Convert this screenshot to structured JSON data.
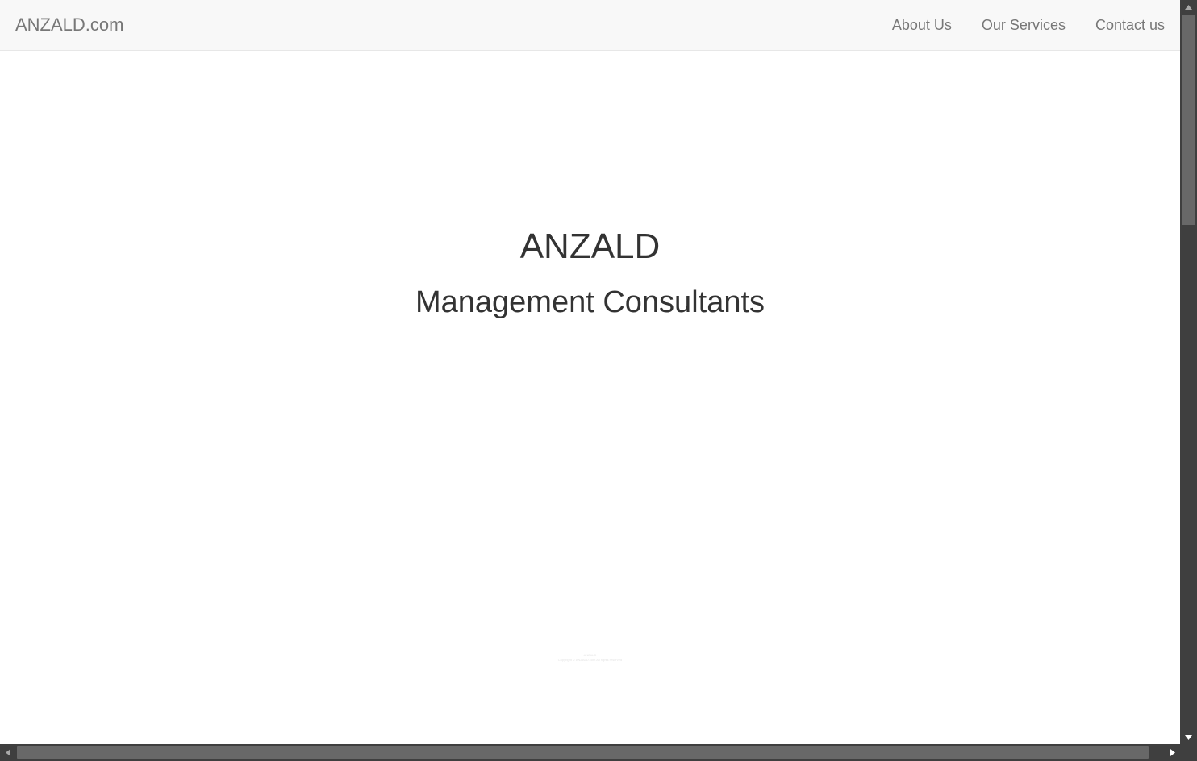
{
  "navbar": {
    "brand": "ANZALD.com",
    "links": [
      "About Us",
      "Our Services",
      "Contact us"
    ]
  },
  "hero": {
    "title": "ANZALD",
    "subtitle": "Management Consultants"
  },
  "footer": {
    "line1": "ANZALD",
    "line2": "Copyright © ANZALD.com All rights reserved"
  },
  "icons": {
    "scroll_up": "arrow-up-icon",
    "scroll_down": "arrow-down-icon",
    "scroll_left": "arrow-left-icon",
    "scroll_right": "arrow-right-icon"
  },
  "colors": {
    "navbar_bg": "#f8f8f8",
    "nav_text": "#777777",
    "hero_text": "#333333",
    "scrollbar_track": "#3f3f3f",
    "scrollbar_thumb": "#686868"
  }
}
